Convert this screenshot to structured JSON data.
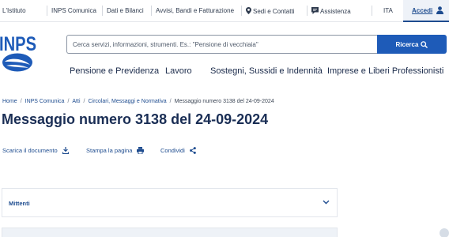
{
  "topbar": {
    "links": [
      "L'Istituto",
      "INPS Comunica",
      "Dati e Bilanci",
      "Avvisi, Bandi e Fatturazione",
      "Sedi e Contatti",
      "Assistenza"
    ],
    "language": "ITA",
    "login_label": "Accedi"
  },
  "header": {
    "logo_text": "INPS",
    "search_placeholder": "Cerca servizi, informazioni, strumenti. Es.: \"Pensione di vecchiaia\"",
    "search_button": "Ricerca"
  },
  "nav": {
    "items": [
      "Pensione e Previdenza",
      "Lavoro",
      "Sostegni, Sussidi e Indennità",
      "Imprese e Liberi Professionisti"
    ]
  },
  "breadcrumb": {
    "items": [
      "Home",
      "INPS Comunica",
      "Atti",
      "Circolari, Messaggi e Normativa"
    ],
    "current": "Messaggio numero 3138 del 24-09-2024"
  },
  "page": {
    "title": "Messaggio numero 3138 del 24-09-2024"
  },
  "actions": {
    "download": "Scarica il documento",
    "print": "Stampa la pagina",
    "share": "Condividi"
  },
  "accordion": {
    "label": "Mittenti"
  },
  "colors": {
    "primary": "#1e5bb8",
    "link": "#1e4c8f",
    "title": "#1a2e55"
  }
}
